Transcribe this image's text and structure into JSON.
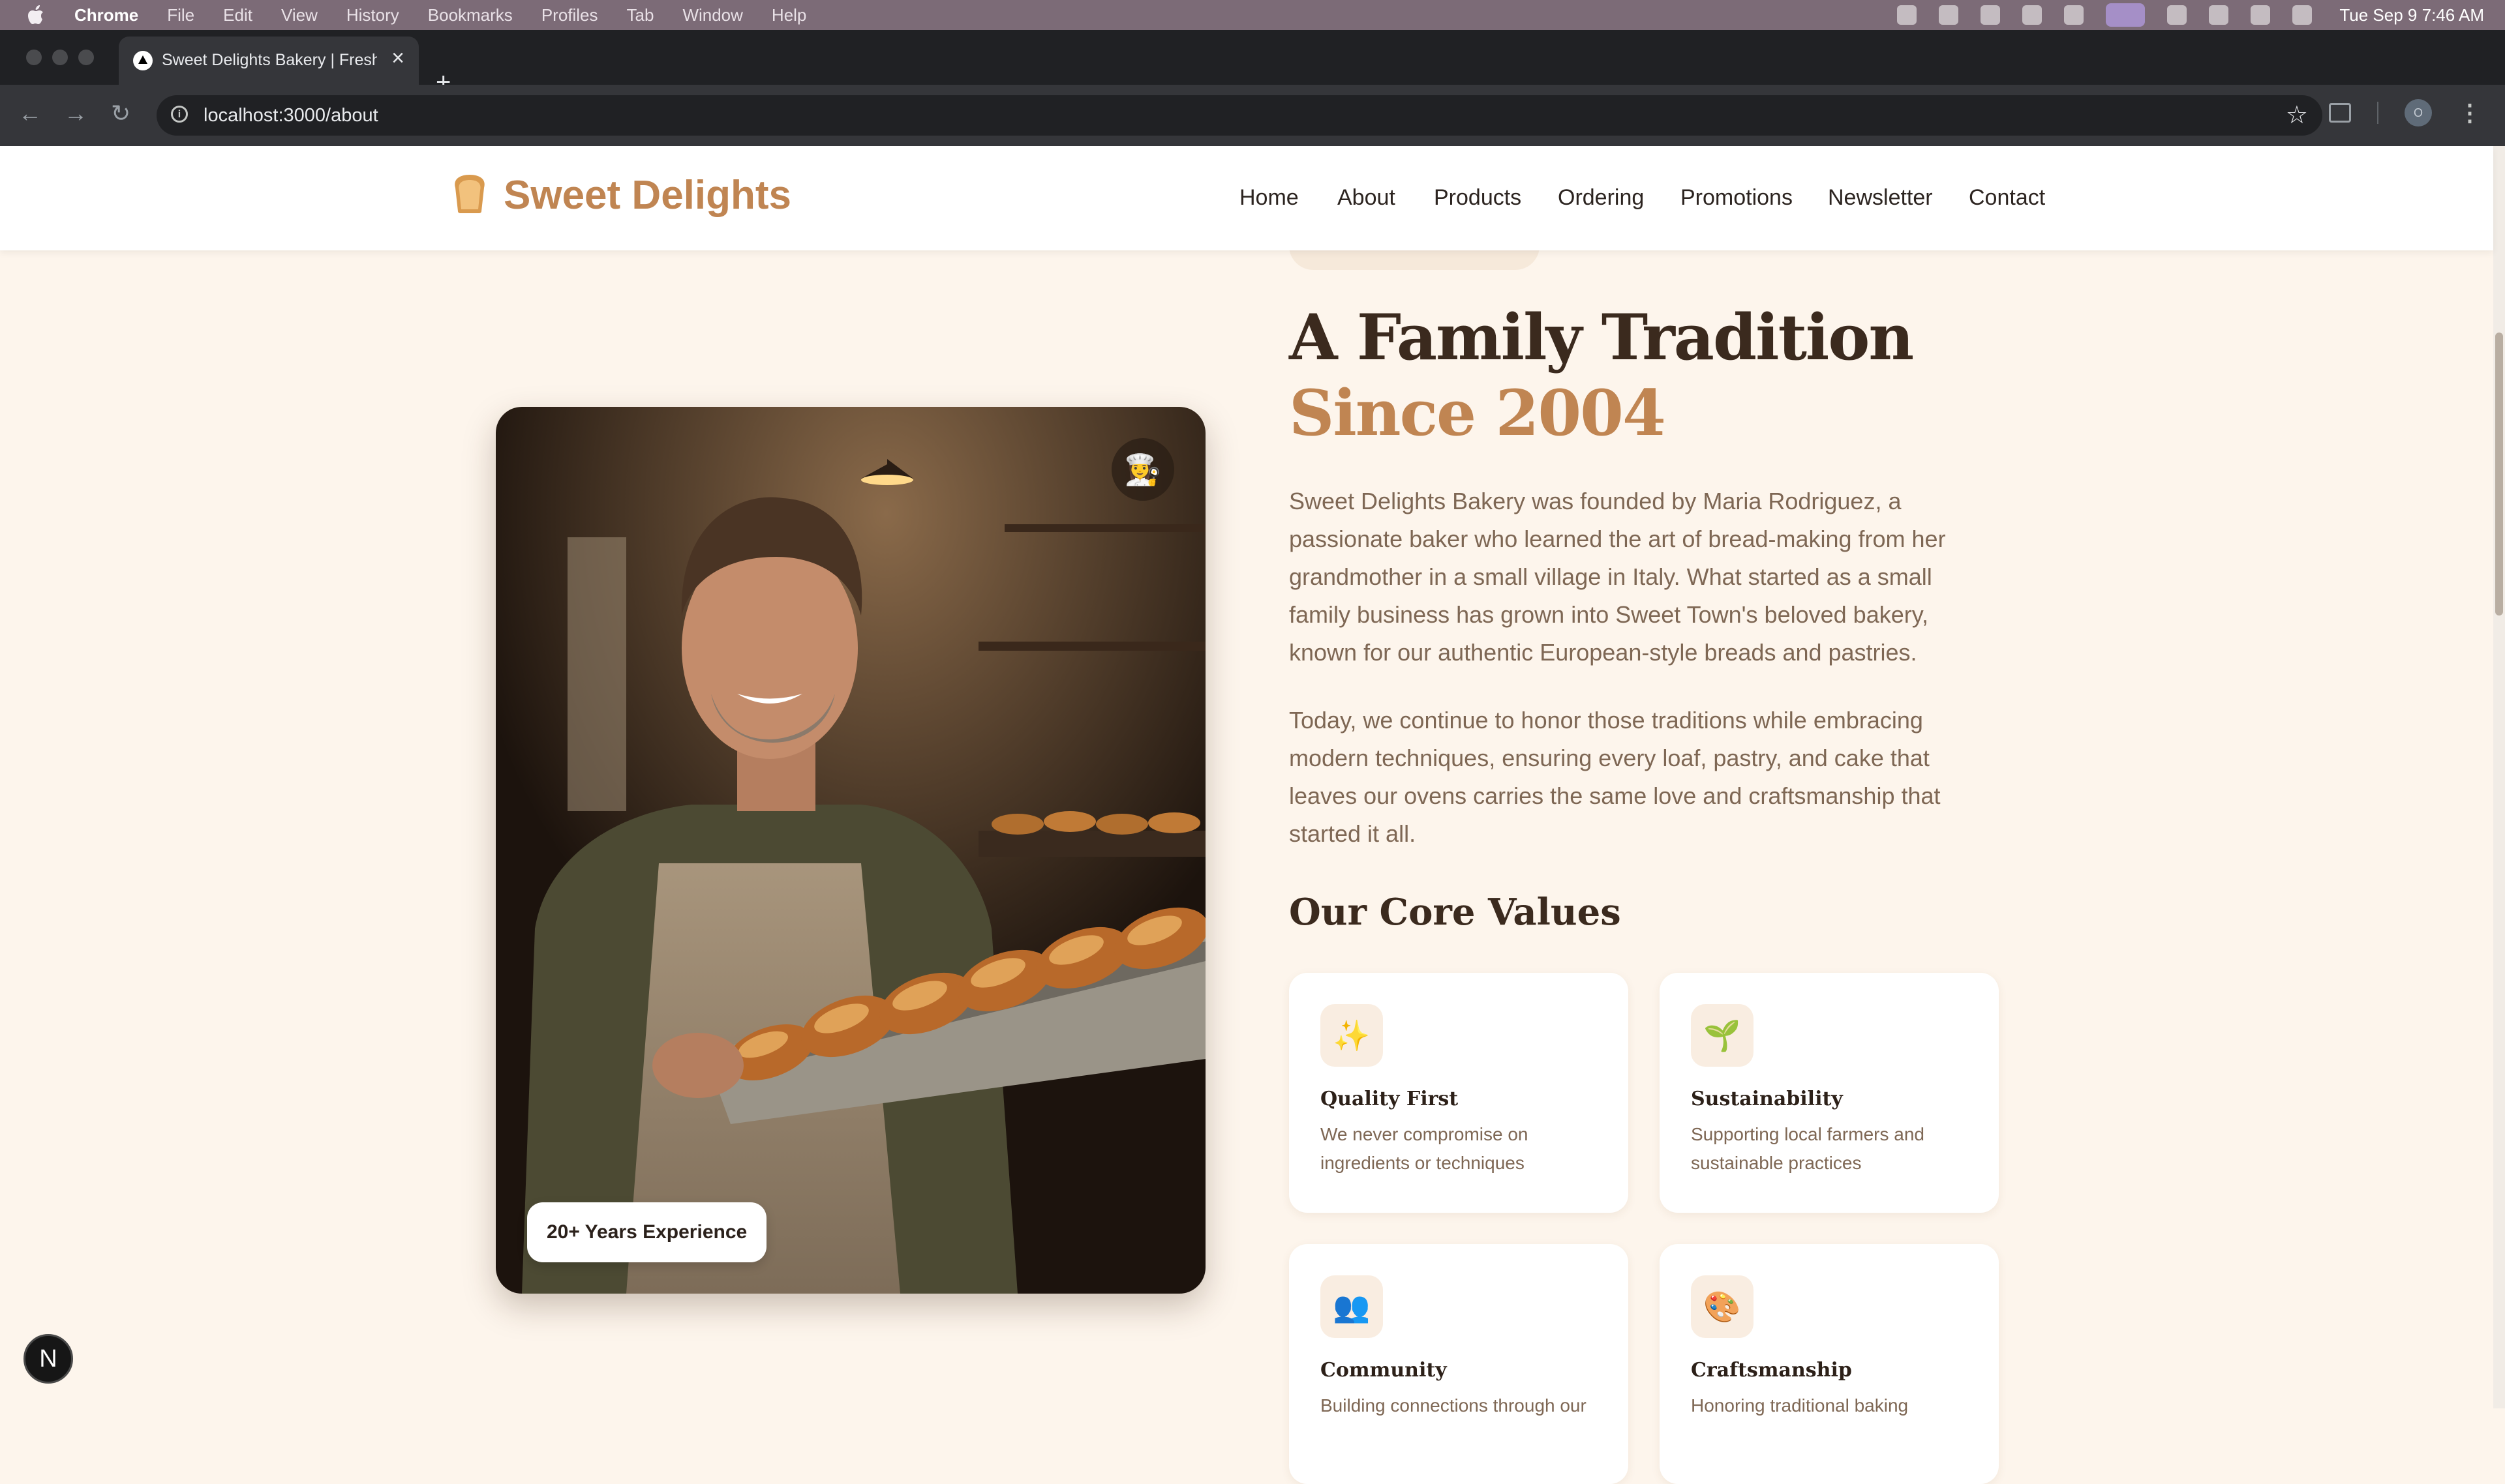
{
  "menubar": {
    "app": "Chrome",
    "items": [
      "File",
      "Edit",
      "View",
      "History",
      "Bookmarks",
      "Profiles",
      "Tab",
      "Window",
      "Help"
    ],
    "clock": "Tue Sep 9  7:46 AM"
  },
  "browser": {
    "tab_title": "Sweet Delights Bakery | Fresh",
    "url": "localhost:3000/about",
    "profile_initial": "O"
  },
  "site": {
    "logo_emoji": "🍞",
    "brand": "Sweet Delights",
    "nav": [
      "Home",
      "About",
      "Products",
      "Ordering",
      "Promotions",
      "Newsletter",
      "Contact"
    ],
    "accent_color": "#c08552"
  },
  "about": {
    "heading_line1": "A Family Tradition",
    "heading_line2": "Since 2004",
    "paragraph1": "Sweet Delights Bakery was founded by Maria Rodriguez, a passionate baker who learned the art of bread-making from her grandmother in a small village in Italy. What started as a small family business has grown into Sweet Town's beloved bakery, known for our authentic European-style breads and pastries.",
    "paragraph2": "Today, we continue to honor those traditions while embracing modern techniques, ensuring every loaf, pastry, and cake that leaves our ovens carries the same love and craftsmanship that started it all.",
    "image_badge_emoji": "👩‍🍳",
    "experience_label": "20+ Years Experience",
    "values_title": "Our Core Values",
    "values": [
      {
        "icon": "✨",
        "title": "Quality First",
        "desc": "We never compromise on ingredients or techniques"
      },
      {
        "icon": "🌱",
        "title": "Sustainability",
        "desc": "Supporting local farmers and sustainable practices"
      },
      {
        "icon": "👥",
        "title": "Community",
        "desc": "Building connections through our"
      },
      {
        "icon": "🎨",
        "title": "Craftsmanship",
        "desc": "Honoring traditional baking"
      }
    ]
  },
  "devtools_badge": "N"
}
